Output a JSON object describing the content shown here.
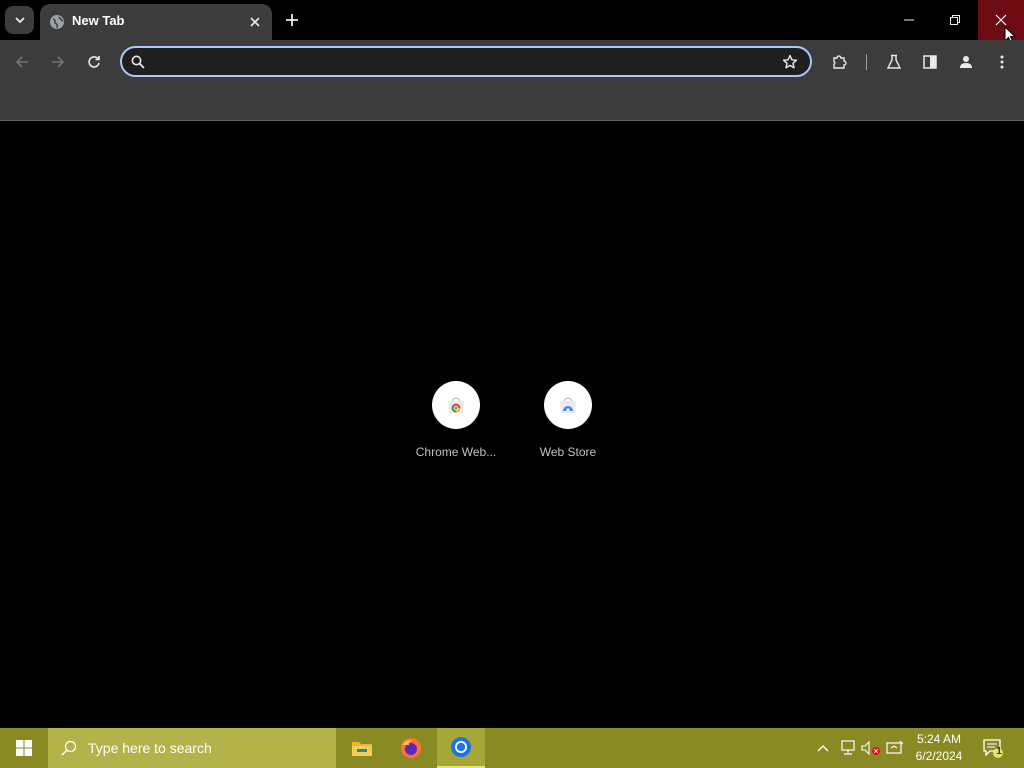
{
  "colors": {
    "accent": "#a8c7fa",
    "close_hover": "#6e0b12",
    "taskbar": "#8a8a24"
  },
  "tab": {
    "title": "New Tab"
  },
  "omnibox": {
    "value": "",
    "placeholder": ""
  },
  "shortcuts": [
    {
      "label": "Chrome Web...",
      "icon": "chrome-web-store-icon"
    },
    {
      "label": "Web Store",
      "icon": "web-store-icon"
    }
  ],
  "taskbar": {
    "search_placeholder": "Type here to search",
    "apps": [
      "file-explorer-icon",
      "firefox-icon",
      "chrome-icon"
    ],
    "clock_time": "5:24 AM",
    "clock_date": "6/2/2024",
    "notification_count": "1"
  }
}
